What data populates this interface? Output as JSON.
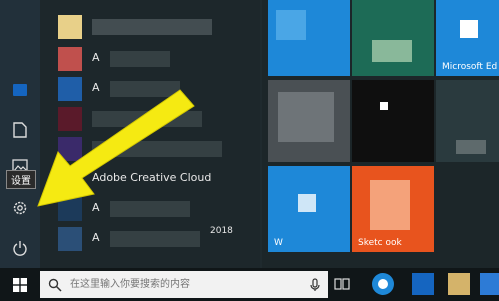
{
  "tooltip": "设置",
  "search": {
    "placeholder": "在这里输入你要搜索的内容"
  },
  "apps": [
    {
      "label": "A"
    },
    {
      "label": "A"
    },
    {
      "label": ""
    },
    {
      "label": ""
    },
    {
      "label": ""
    },
    {
      "label": "Adobe Creative Cloud"
    },
    {
      "label": "A"
    },
    {
      "label": "A"
    },
    {
      "label": "2018"
    }
  ],
  "tiles": {
    "edge": "Microsoft Ed",
    "sketch": "Sketc    ook",
    "w": "W"
  },
  "colors": {
    "tile_blue": "#1e88d8",
    "tile_orange": "#e8541e",
    "arrow": "#f5ea12",
    "accent": "#0078d7"
  },
  "icons": {
    "windows": "windows-icon",
    "document": "document-icon",
    "pictures": "pictures-icon",
    "settings": "settings-gear-icon",
    "power": "power-icon",
    "search": "search-icon",
    "mic": "microphone-icon",
    "task_view": "task-view-icon"
  }
}
